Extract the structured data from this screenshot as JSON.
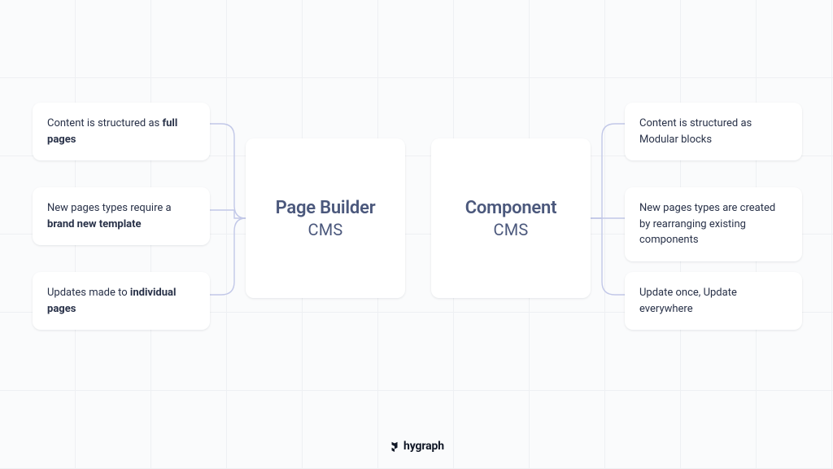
{
  "left_features": [
    {
      "prefix": "Content is structured as ",
      "bold": "full pages",
      "suffix": ""
    },
    {
      "prefix": "New pages types require a ",
      "bold": "brand new template",
      "suffix": ""
    },
    {
      "prefix": "Updates made to ",
      "bold": "individual pages",
      "suffix": ""
    }
  ],
  "right_features": [
    {
      "prefix": "Content is structured as ",
      "bold": "Modular blocks",
      "suffix": ""
    },
    {
      "prefix": "New pages types are created by ",
      "bold": "rearranging existing components",
      "suffix": ""
    },
    {
      "prefix": "Update once, ",
      "bold": "Update everywhere",
      "suffix": ""
    }
  ],
  "center_left": {
    "title": "Page Builder",
    "sub": "CMS"
  },
  "center_right": {
    "title": "Component",
    "sub": "CMS"
  },
  "brand": "hygraph"
}
